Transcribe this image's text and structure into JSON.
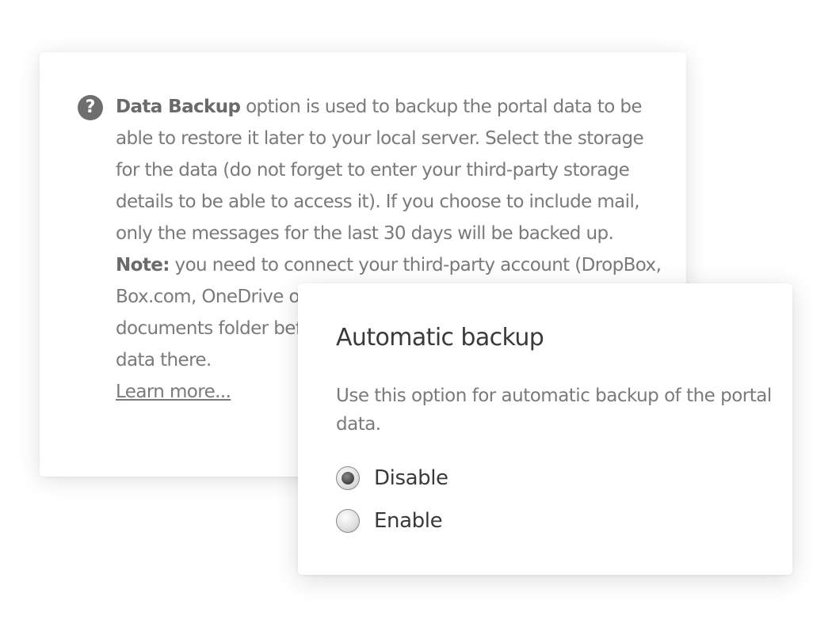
{
  "help_card": {
    "icon": "question-circle-icon",
    "title_bold": "Data Backup",
    "body": " option is used to backup the portal data to be able to restore it later to your local server. Select the storage for the data (do not forget to enter your third-party storage details to be able to access it). If you choose to include mail, only the messages for the last 30 days will be backed up.",
    "note_bold": "Note:",
    "note_body": " you need to connect your third-party account (DropBox, Box.com, OneDrive or Google Drive) to ONLYOFFICE Common documents folder before you will be able to save your backup data there.",
    "learn_more": "Learn more..."
  },
  "auto_backup": {
    "title": "Automatic backup",
    "description": "Use this option for automatic backup of the portal data.",
    "options": [
      {
        "label": "Disable",
        "checked": true
      },
      {
        "label": "Enable",
        "checked": false
      }
    ]
  }
}
